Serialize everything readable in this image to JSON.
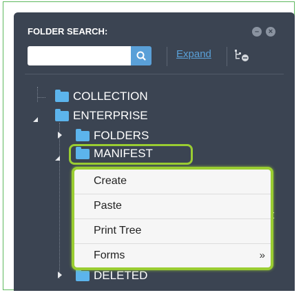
{
  "panel": {
    "title": "FOLDER SEARCH:",
    "search_placeholder": "",
    "search_value": "",
    "expand_label": "Expand"
  },
  "tree": {
    "nodes": [
      {
        "label": "COLLECTION"
      },
      {
        "label": "ENTERPRISE"
      },
      {
        "label": "FOLDERS"
      },
      {
        "label": "MANIFEST"
      },
      {
        "label": "DELETED"
      }
    ]
  },
  "context_menu": {
    "items": [
      {
        "label": "Create"
      },
      {
        "label": "Paste"
      },
      {
        "label": "Print Tree"
      },
      {
        "label": "Forms",
        "submenu": "»"
      }
    ]
  },
  "partial_label": "nt",
  "colors": {
    "panel_bg": "#3b4452",
    "accent_blue": "#5aa0d8",
    "folder_blue": "#5cb4ec",
    "highlight_green": "#9acd32",
    "frame_green": "#5cb85c"
  }
}
